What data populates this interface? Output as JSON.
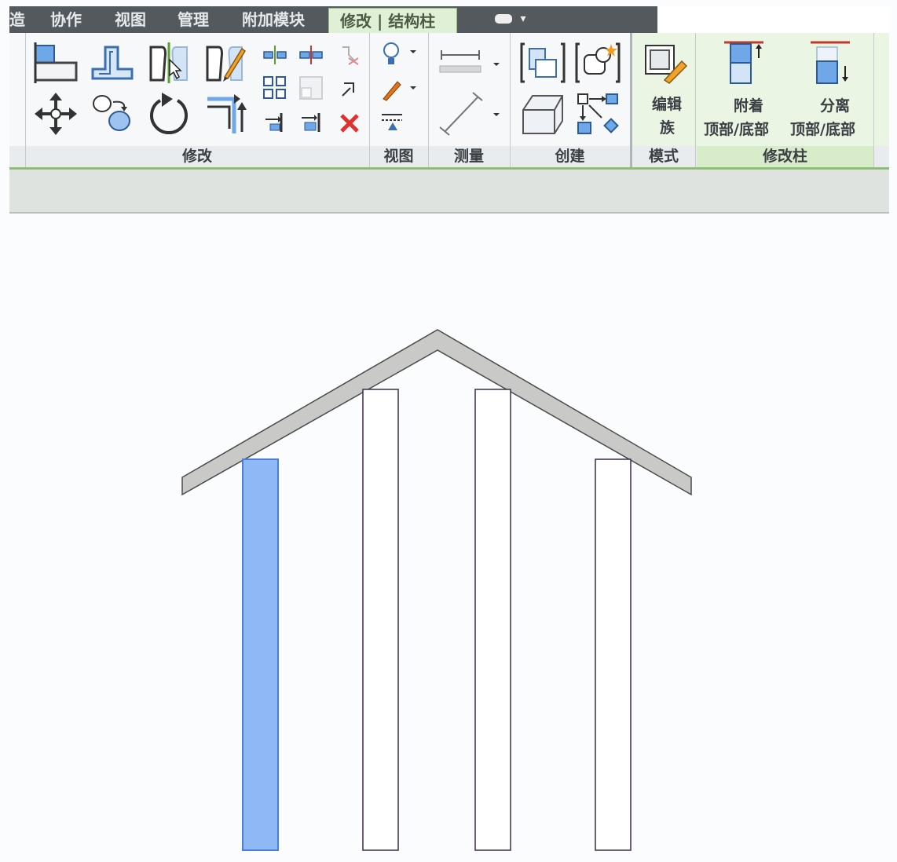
{
  "tabs": [
    {
      "label": "协作"
    },
    {
      "label": "视图"
    },
    {
      "label": "管理"
    },
    {
      "label": "附加模块"
    }
  ],
  "tab_cut_left": "造",
  "active_tab": {
    "label": "修改 | 结构柱"
  },
  "panels": {
    "modify": "修改",
    "view": "视图",
    "measure": "测量",
    "create": "创建",
    "mode": "模式",
    "modify_column": "修改柱"
  },
  "mode_buttons": {
    "edit_family_line1": "编辑",
    "edit_family_line2": "族"
  },
  "column_buttons": {
    "attach_line1": "附着",
    "attach_line2": "顶部/底部",
    "detach_line1": "分离",
    "detach_line2": "顶部/底部"
  },
  "colors": {
    "ribbon_accent": "#8fbf73",
    "selected_column_fill": "#8fb8f7",
    "selected_column_stroke": "#4a7fd8",
    "roof_fill": "#c9cac7",
    "delete_icon": "#e03030"
  },
  "icons": [
    "align-icon",
    "offset-icon",
    "mirror-axis-icon",
    "mirror-draw-icon",
    "move-icon",
    "copy-icon",
    "rotate-icon",
    "trim-extend-icon",
    "split-icon",
    "array-icon",
    "scale-icon",
    "pin-icon",
    "unpin-icon",
    "delete-icon",
    "override-graphics-icon",
    "paint-icon",
    "hide-icon",
    "measure-distance-icon",
    "measure-angle-icon",
    "create-group-icon",
    "create-parts-icon",
    "similar-icon",
    "edit-family-icon",
    "attach-top-bottom-icon",
    "detach-top-bottom-icon"
  ]
}
